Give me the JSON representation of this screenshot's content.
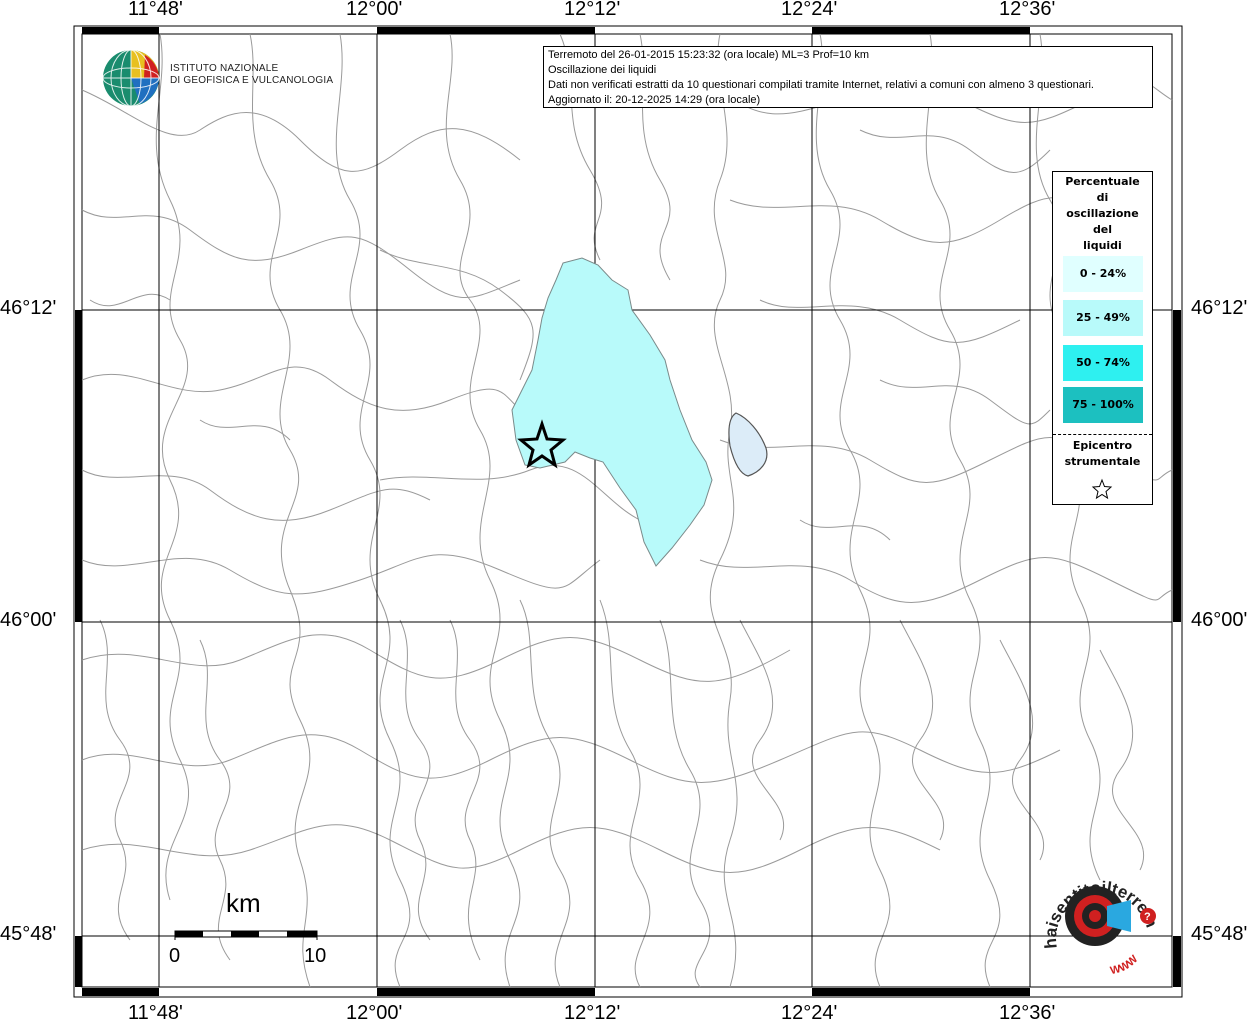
{
  "info": {
    "line1": "Terremoto del 26-01-2015 15:23:32 (ora locale) ML=3 Prof=10 km",
    "line2": "Oscillazione dei liquidi",
    "line3": "Dati non verificati estratti da 10 questionari compilati tramite Internet, relativi a comuni con almeno 3 questionari.",
    "line4": "Aggiornato il: 20-12-2025 14:29 (ora locale)"
  },
  "institute": {
    "line1": "ISTITUTO NAZIONALE",
    "line2": "DI GEOFISICA E VULCANOLOGIA"
  },
  "axes": {
    "top": [
      "11°48'",
      "12°00'",
      "12°12'",
      "12°24'",
      "12°36'"
    ],
    "bottom": [
      "11°48'",
      "12°00'",
      "12°12'",
      "12°24'",
      "12°36'"
    ],
    "left": [
      "46°12'",
      "46°00'",
      "45°48'"
    ],
    "right": [
      "46°12'",
      "46°00'",
      "45°48'"
    ]
  },
  "legend": {
    "title_lines": [
      "Percentuale",
      "di",
      "oscillazione",
      "del",
      "liquidi"
    ],
    "classes": [
      {
        "label": "0 - 24%",
        "color": "#e0ffff"
      },
      {
        "label": "25 - 49%",
        "color": "#b8fafa"
      },
      {
        "label": "50 - 74%",
        "color": "#2ef0f0"
      },
      {
        "label": "75 - 100%",
        "color": "#1cc0c0"
      }
    ],
    "epicenter_line1": "Epicentro",
    "epicenter_line2": "strumentale"
  },
  "scale": {
    "unit": "km",
    "start": "0",
    "end": "10"
  },
  "sentito": {
    "text": "haisentitoilterremoto.it",
    "www": "WWW"
  },
  "colors": {
    "fill_25_49": "#b8fafa",
    "lake": "#dcecf8",
    "borders": "#a0a0a0",
    "grid": "#000000"
  }
}
